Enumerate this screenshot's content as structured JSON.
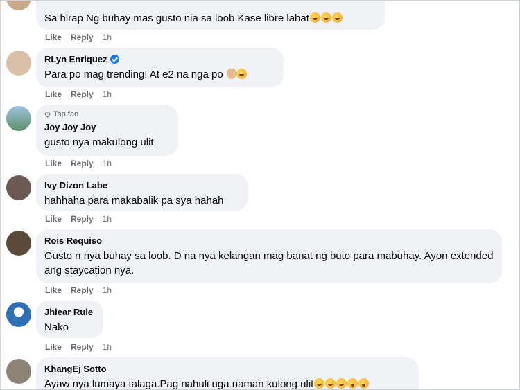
{
  "actions": {
    "like": "Like",
    "reply": "Reply"
  },
  "comments": [
    {
      "name": "",
      "text": "Sa hirap Ng buhay mas gusto nia sa loob Kase libre lahat",
      "time": "1h",
      "emoji": [
        "laugh",
        "laugh",
        "laugh"
      ],
      "avatar_color": "#caa98a"
    },
    {
      "name": "RLyn Enriquez",
      "verified": true,
      "text": "Para po mag trending! At e2 na nga po",
      "time": "1h",
      "emoji": [
        "hand",
        "laugh"
      ],
      "avatar_color": "#d9c0a8"
    },
    {
      "name": "Joy Joy Joy",
      "badge": "Top fan",
      "text": "gusto nya makulong ulit",
      "time": "1h",
      "emoji": [],
      "avatar_color": "#7fa9c9"
    },
    {
      "name": "Ivy Dizon Labe",
      "text": "hahhaha para makabalik pa sya hahah",
      "time": "1h",
      "emoji": [],
      "avatar_color": "#6b5a52"
    },
    {
      "name": "Rois Requiso",
      "text": "Gusto n nya buhay sa loob. D na nya kelangan mag banat ng buto para mabuhay. Ayon extended ang staycation nya.",
      "time": "1h",
      "emoji": [],
      "avatar_color": "#5a4a3a"
    },
    {
      "name": "Jhiear Rule",
      "text": "Nako",
      "time": "1h",
      "emoji": [],
      "avatar_color": "#2f6fb3"
    },
    {
      "name": "KhangEj Sotto",
      "text": "Ayaw nya lumaya talaga.Pag nahuli nga naman kulong ulit",
      "time": "",
      "emoji": [
        "laugh",
        "laugh",
        "laugh",
        "shock",
        "shock"
      ],
      "avatar_color": "#8c8276"
    }
  ],
  "colors": {
    "bubble": "#f0f2f5",
    "meta": "#65676b",
    "verified": "#1877f2"
  }
}
